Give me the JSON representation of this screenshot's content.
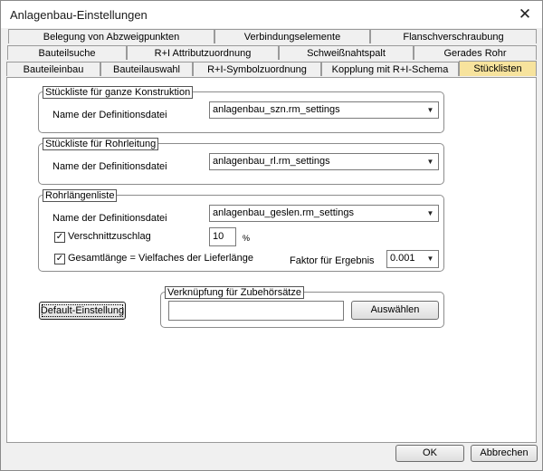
{
  "window": {
    "title": "Anlagenbau-Einstellungen"
  },
  "tabs": {
    "row1": [
      "Belegung von Abzweigpunkten",
      "Verbindungselemente",
      "Flanschverschraubung"
    ],
    "row2": [
      "Bauteilsuche",
      "R+I Attributzuordnung",
      "Schweißnahtspalt",
      "Gerades Rohr"
    ],
    "row3": [
      "Bauteileinbau",
      "Bauteilauswahl",
      "R+I-Symbolzuordnung",
      "Kopplung mit R+I-Schema",
      "Stücklisten"
    ],
    "active": "Stücklisten"
  },
  "groups": {
    "konstruktion": {
      "title": "Stückliste für ganze Konstruktion",
      "label": "Name der Definitionsdatei",
      "value": "anlagenbau_szn.rm_settings"
    },
    "rohrleitung": {
      "title": "Stückliste für Rohrleitung",
      "label": "Name der Definitionsdatei",
      "value": "anlagenbau_rl.rm_settings"
    },
    "rohrlaengen": {
      "title": "Rohrlängenliste",
      "label": "Name der Definitionsdatei",
      "value": "anlagenbau_geslen.rm_settings",
      "verschnitt_label": "Verschnittzuschlag",
      "verschnitt_value": "10",
      "verschnitt_unit": "%",
      "gesamt_label": "Gesamtlänge = Vielfaches der Lieferlänge",
      "faktor_label": "Faktor für Ergebnis",
      "faktor_value": "0.001"
    },
    "zubehoer": {
      "title": "Verknüpfung für Zubehörsätze",
      "value": "",
      "button": "Auswählen"
    }
  },
  "buttons": {
    "default": "Default-Einstellung",
    "ok": "OK",
    "cancel": "Abbrechen"
  }
}
